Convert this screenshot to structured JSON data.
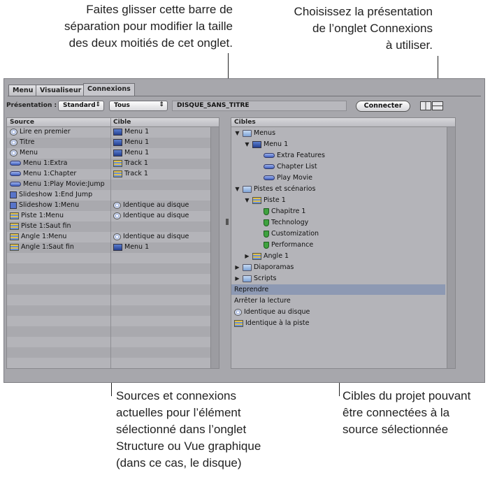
{
  "callouts": {
    "drag_lines": [
      "Faites glisser cette barre de",
      "séparation pour modifier la taille",
      "des deux moitiés de cet onglet."
    ],
    "layout_lines": [
      "Choisissez la présentation",
      "de l’onglet Connexions",
      "à utiliser."
    ],
    "sources_lines": [
      "Sources et connexions",
      "actuelles pour l’élément",
      "sélectionné dans l’onglet",
      "Structure ou Vue graphique",
      "(dans ce cas, le disque)"
    ],
    "targets_lines": [
      "Cibles du projet pouvant",
      "être connectées à la",
      "source sélectionnée"
    ]
  },
  "tabs": [
    "Menu",
    "Visualiseur",
    "Connexions"
  ],
  "toolbar": {
    "presentation_label": "Présentation :",
    "presentation_value": "Standard",
    "filter_value": "Tous",
    "disc_name": "DISQUE_SANS_TITRE",
    "connect_label": "Connecter"
  },
  "left_pane": {
    "source_header": "Source",
    "target_header": "Cible",
    "rows": [
      {
        "source": "Lire en premier",
        "source_icon": "disc-icon",
        "target": "Menu 1",
        "target_icon": "menu-icon"
      },
      {
        "source": "Titre",
        "source_icon": "disc-icon",
        "target": "Menu 1",
        "target_icon": "menu-icon"
      },
      {
        "source": "Menu",
        "source_icon": "disc-icon",
        "target": "Menu 1",
        "target_icon": "menu-icon"
      },
      {
        "source": "Menu 1:Extra",
        "source_icon": "button-icon",
        "target": "Track 1",
        "target_icon": "track-icon"
      },
      {
        "source": "Menu 1:Chapter",
        "source_icon": "button-icon",
        "target": "Track 1",
        "target_icon": "track-icon"
      },
      {
        "source": "Menu 1:Play Movie:Jump",
        "source_icon": "button-icon",
        "target": "",
        "target_icon": ""
      },
      {
        "source": "Slideshow 1:End Jump",
        "source_icon": "slideshow-icon",
        "target": "",
        "target_icon": ""
      },
      {
        "source": "Slideshow 1:Menu",
        "source_icon": "slideshow-icon",
        "target": "Identique au disque",
        "target_icon": "disc-icon"
      },
      {
        "source": "Piste 1:Menu",
        "source_icon": "track-icon",
        "target": "Identique au disque",
        "target_icon": "disc-icon"
      },
      {
        "source": "Piste 1:Saut fin",
        "source_icon": "track-icon",
        "target": "",
        "target_icon": ""
      },
      {
        "source": "Angle 1:Menu",
        "source_icon": "track-icon",
        "target": "Identique au disque",
        "target_icon": "disc-icon"
      },
      {
        "source": "Angle 1:Saut fin",
        "source_icon": "track-icon",
        "target": "Menu 1",
        "target_icon": "menu-icon"
      }
    ]
  },
  "right_pane": {
    "header": "Cibles",
    "tree": [
      {
        "label": "Menus",
        "icon": "folder-icon",
        "level": 0,
        "toggle": "open"
      },
      {
        "label": "Menu 1",
        "icon": "menu-icon",
        "level": 1,
        "toggle": "open"
      },
      {
        "label": "Extra Features",
        "icon": "button-icon",
        "level": 3,
        "toggle": ""
      },
      {
        "label": "Chapter List",
        "icon": "button-icon",
        "level": 3,
        "toggle": ""
      },
      {
        "label": "Play Movie",
        "icon": "button-icon",
        "level": 3,
        "toggle": ""
      },
      {
        "label": "Pistes et scénarios",
        "icon": "folder-icon",
        "level": 0,
        "toggle": "open"
      },
      {
        "label": "Piste 1",
        "icon": "track-icon",
        "level": 1,
        "toggle": "open"
      },
      {
        "label": "Chapitre 1",
        "icon": "marker-icon",
        "level": 3,
        "toggle": ""
      },
      {
        "label": "Technology",
        "icon": "marker-icon",
        "level": 3,
        "toggle": ""
      },
      {
        "label": "Customization",
        "icon": "marker-icon",
        "level": 3,
        "toggle": ""
      },
      {
        "label": "Performance",
        "icon": "marker-icon",
        "level": 3,
        "toggle": ""
      },
      {
        "label": "Angle 1",
        "icon": "track-icon",
        "level": 1,
        "toggle": "closed"
      },
      {
        "label": "Diaporamas",
        "icon": "folder-icon",
        "level": 0,
        "toggle": "closed"
      },
      {
        "label": "Scripts",
        "icon": "folder-icon",
        "level": 0,
        "toggle": "closed"
      },
      {
        "label": "Reprendre",
        "icon": "",
        "level": -1,
        "toggle": "",
        "selected": true
      },
      {
        "label": "Arrêter la lecture",
        "icon": "",
        "level": -1,
        "toggle": ""
      },
      {
        "label": "Identique au disque",
        "icon": "disc-icon",
        "level": -1,
        "toggle": ""
      },
      {
        "label": "Identique à la piste",
        "icon": "track-icon",
        "level": -1,
        "toggle": ""
      }
    ]
  },
  "colors": {
    "window_bg": "#a7a7ac",
    "pane_bg": "#b4b4b9",
    "selection": "#8d99b3"
  }
}
